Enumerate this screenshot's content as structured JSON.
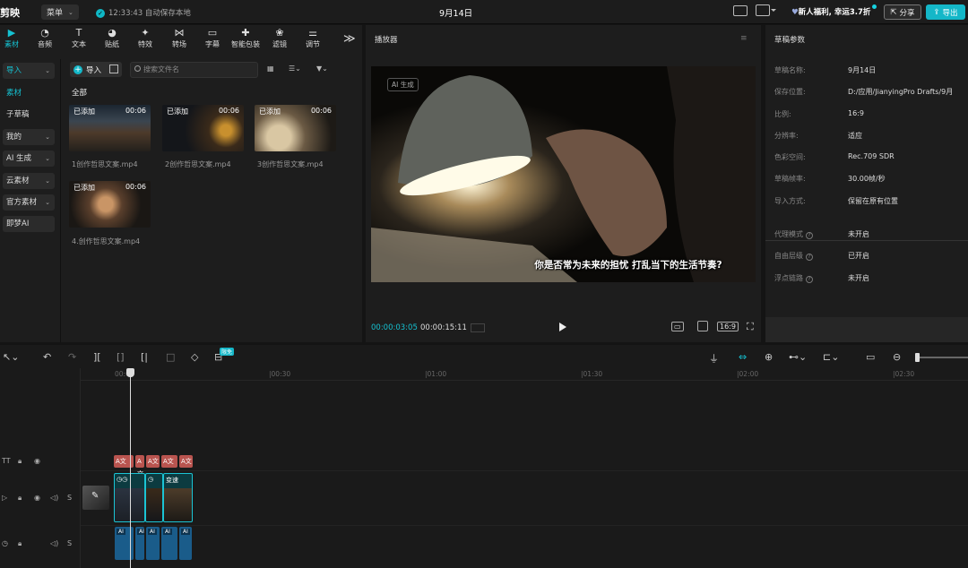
{
  "app": {
    "logo": "剪映",
    "menu_label": "菜单",
    "save_status": "12:33:43 自动保存本地",
    "project_title": "9月14日",
    "promo": "新人福利, 幸运3.7折",
    "share": "分享",
    "export": "导出"
  },
  "tool_tabs": [
    {
      "label": "素材",
      "icon": "media-icon"
    },
    {
      "label": "音频",
      "icon": "audio-icon"
    },
    {
      "label": "文本",
      "icon": "text-icon"
    },
    {
      "label": "贴纸",
      "icon": "sticker-icon"
    },
    {
      "label": "特效",
      "icon": "effects-icon"
    },
    {
      "label": "转场",
      "icon": "transition-icon"
    },
    {
      "label": "字幕",
      "icon": "caption-icon"
    },
    {
      "label": "智能包装",
      "icon": "smart-pack-icon"
    },
    {
      "label": "滤镜",
      "icon": "filter-icon"
    },
    {
      "label": "调节",
      "icon": "adjust-icon"
    }
  ],
  "sidenav": [
    "导入",
    "素材",
    "子草稿",
    "我的",
    "AI 生成",
    "云素材",
    "官方素材",
    "即梦AI"
  ],
  "media": {
    "import_label": "导入",
    "search_placeholder": "搜索文件名",
    "all_label": "全部",
    "items": [
      {
        "tag": "已添加",
        "duration": "00:06",
        "name": "1创作哲思文案.mp4"
      },
      {
        "tag": "已添加",
        "duration": "00:06",
        "name": "2创作哲思文案.mp4"
      },
      {
        "tag": "已添加",
        "duration": "00:06",
        "name": "3创作哲思文案.mp4"
      },
      {
        "tag": "已添加",
        "duration": "00:06",
        "name": "4.创作哲思文案.mp4"
      }
    ]
  },
  "player": {
    "title": "播放器",
    "ai_badge": "AI 生成",
    "subtitle": "你是否常为未来的担忧 打乱当下的生活节奏?",
    "current_time": "00:00:03:05",
    "total_time": "00:00:15:11",
    "aspect": "16:9"
  },
  "props": {
    "title": "草稿参数",
    "rows": [
      {
        "label": "草稿名称:",
        "value": "9月14日"
      },
      {
        "label": "保存位置:",
        "value": "D:/应用/JianyingPro Drafts/9月"
      },
      {
        "label": "比例:",
        "value": "16:9"
      },
      {
        "label": "分辨率:",
        "value": "适应"
      },
      {
        "label": "色彩空间:",
        "value": "Rec.709 SDR"
      },
      {
        "label": "草稿帧率:",
        "value": "30.00帧/秒"
      },
      {
        "label": "导入方式:",
        "value": "保留在原有位置"
      }
    ],
    "rows2": [
      {
        "label": "代理模式",
        "value": "未开启"
      },
      {
        "label": "自由层级",
        "value": "已开启"
      },
      {
        "label": "浮点链路",
        "value": "未开启"
      }
    ]
  },
  "timeline": {
    "free_badge": "限免",
    "ticks": [
      "00:00",
      "|00:30",
      "|01:00",
      "|01:30",
      "|02:00",
      "|02:30"
    ],
    "text_clip_label": "A文",
    "video_clip_label": "变速",
    "audio_clip_label": "AI"
  }
}
